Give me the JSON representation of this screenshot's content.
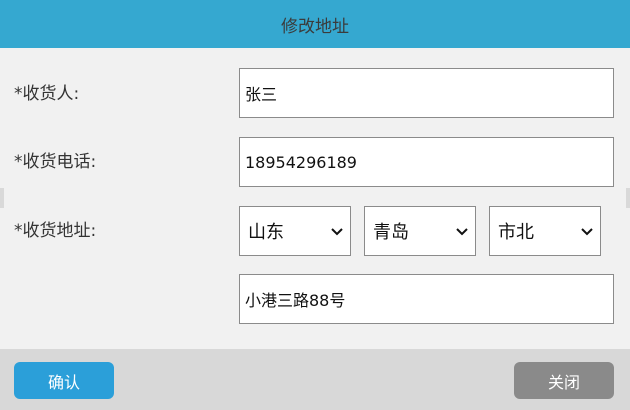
{
  "dialog": {
    "title": "修改地址"
  },
  "form": {
    "receiver": {
      "label": "*收货人:",
      "value": "张三"
    },
    "phone": {
      "label": "*收货电话:",
      "value": "18954296189"
    },
    "address": {
      "label": "*收货地址:",
      "province": "山东",
      "city": "青岛",
      "district": "市北",
      "detail": "小港三路88号"
    }
  },
  "footer": {
    "confirm_label": "确认",
    "close_label": "关闭"
  },
  "colors": {
    "title_bar": "#35a8d0",
    "confirm": "#2b9fd9",
    "close": "#8a8a8a"
  },
  "icons": {
    "select_arrow": "chevron-down-icon"
  }
}
